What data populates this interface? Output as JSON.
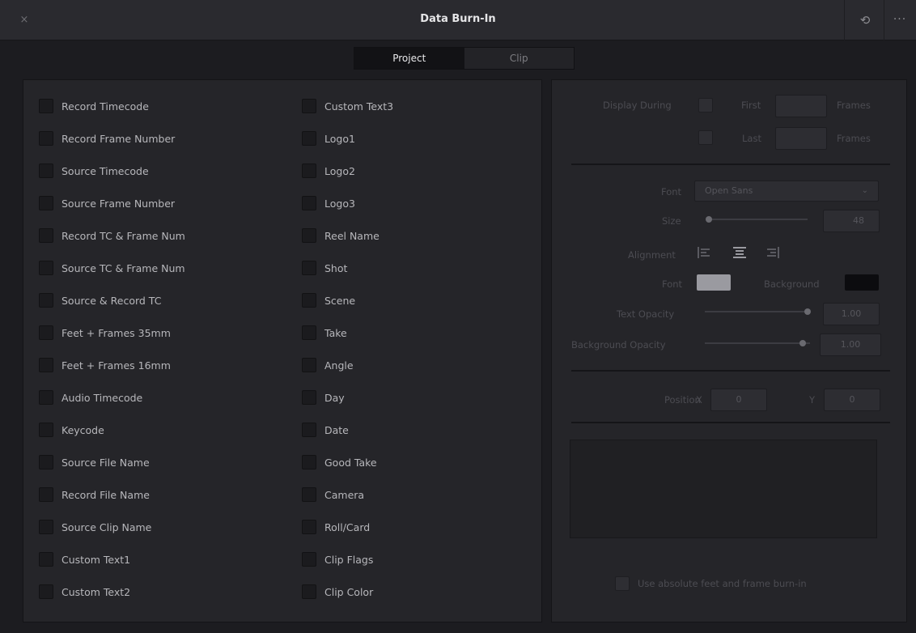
{
  "window": {
    "title": "Data Burn-In",
    "close_glyph": "×",
    "reset_glyph": "⟲",
    "more_glyph": "···"
  },
  "tabs": [
    {
      "label": "Project",
      "active": true
    },
    {
      "label": "Clip",
      "active": false
    }
  ],
  "options_col1": [
    "Record Timecode",
    "Record Frame Number",
    "Source Timecode",
    "Source Frame Number",
    "Record TC & Frame Num",
    "Source TC & Frame Num",
    "Source & Record TC",
    "Feet + Frames 35mm",
    "Feet + Frames 16mm",
    "Audio Timecode",
    "Keycode",
    "Source File Name",
    "Record File Name",
    "Source Clip Name",
    "Custom Text1",
    "Custom Text2"
  ],
  "options_col2": [
    "Custom Text3",
    "Logo1",
    "Logo2",
    "Logo3",
    "Reel Name",
    "Shot",
    "Scene",
    "Take",
    "Angle",
    "Day",
    "Date",
    "Good Take",
    "Camera",
    "Roll/Card",
    "Clip Flags",
    "Clip Color"
  ],
  "settings": {
    "display_during_label": "Display During",
    "first_label": "First",
    "last_label": "Last",
    "frames_label": "Frames",
    "font_label": "Font",
    "font_value": "Open Sans",
    "size_label": "Size",
    "size_value": "48",
    "size_fraction": 0.0,
    "alignment_label": "Alignment",
    "font_color_label": "Font",
    "font_color": "#9a9aa0",
    "background_label": "Background",
    "background_color": "#0c0c0f",
    "text_opacity_label": "Text Opacity",
    "text_opacity_value": "1.00",
    "bg_opacity_label": "Background Opacity",
    "bg_opacity_value": "1.00",
    "position_label": "Position",
    "x_label": "X",
    "x_value": "0",
    "y_label": "Y",
    "y_value": "0",
    "absolute_label": "Use absolute feet and frame burn-in"
  },
  "colors": {
    "accent_active_tab": "#121215",
    "panel_bg": "#252529"
  }
}
